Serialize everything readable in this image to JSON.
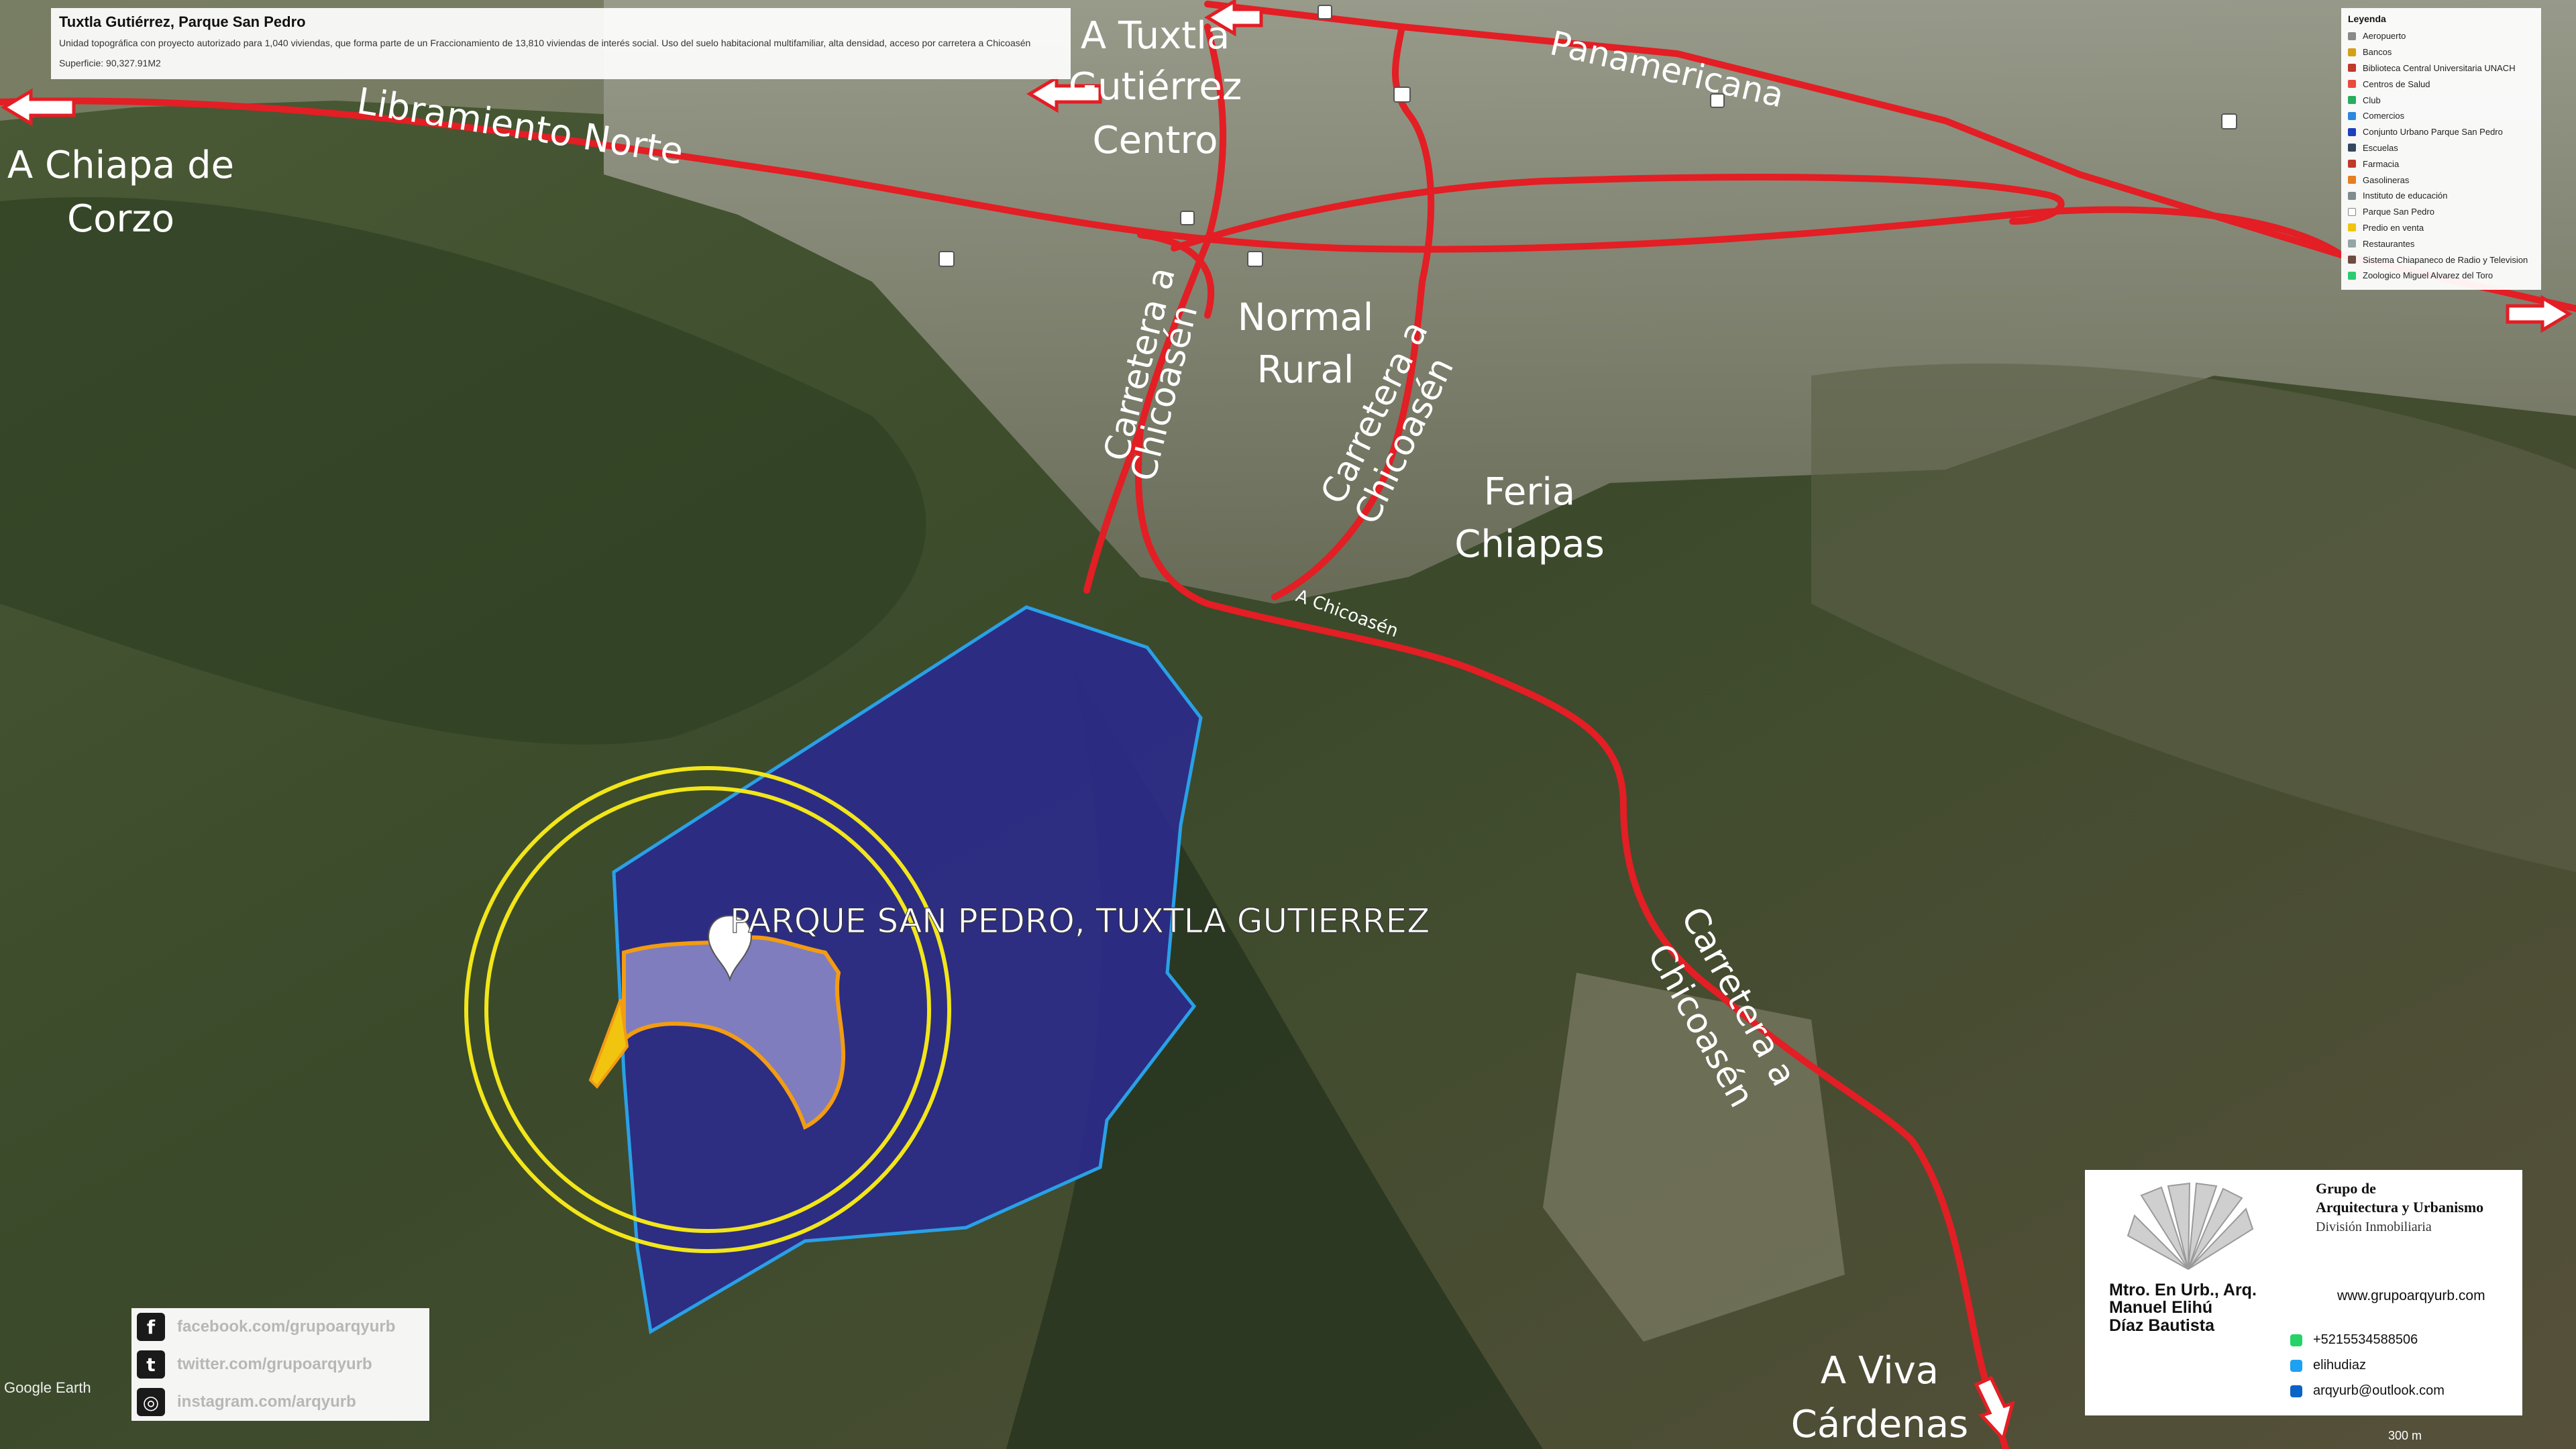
{
  "map": {
    "project_label": "PARQUE SAN PEDRO, TUXTLA GUTIERREZ",
    "place_labels": {
      "chiapa_a": "A Chiapa de",
      "chiapa_b": "Corzo",
      "tuxtla_a": "A Tuxtla",
      "tuxtla_b": "Gutiérrez",
      "tuxtla_c": "Centro",
      "normal_a": "Normal",
      "normal_b": "Rural",
      "feria_a": "Feria",
      "feria_b": "Chiapas",
      "viva_a": "A Viva",
      "viva_b": "Cárdenas"
    },
    "road_labels": {
      "libramiento": "Libramiento Norte",
      "panamericana": "Panamericana",
      "carretera_a": "Carretera a",
      "chicoasen": "Chicoasén",
      "chicoasen_small": "A Chicoasén"
    },
    "colors": {
      "road": "#e31e24",
      "polygon_fill": "#2b2a8c",
      "polygon_stroke": "#2aa0e6",
      "inner_fill": "#8e8cc8",
      "inner_stroke": "#f39c12",
      "ring": "#f2e61a",
      "terrain_dark": "#2d3d22",
      "terrain_light": "#6d6a50"
    }
  },
  "info_panel": {
    "title": "Tuxtla Gutiérrez, Parque San Pedro",
    "description": "Unidad topográfica con proyecto autorizado para 1,040 viviendas, que forma parte de un Fraccionamiento de 13,810 viviendas de interés social. Uso del suelo habitacional multifamiliar, alta densidad, acceso por carretera a Chicoasén",
    "area": "Superficie: 90,327.91M2"
  },
  "legend": {
    "title": "Leyenda",
    "items": [
      {
        "label": "Aeropuerto",
        "color": "#8a8a8a"
      },
      {
        "label": "Bancos",
        "color": "#d4a017"
      },
      {
        "label": "Biblioteca Central Universitaria UNACH",
        "color": "#c0392b"
      },
      {
        "label": "Centros de Salud",
        "color": "#e74c3c"
      },
      {
        "label": "Club",
        "color": "#27ae60"
      },
      {
        "label": "Comercios",
        "color": "#2e86de"
      },
      {
        "label": "Conjunto Urbano Parque San Pedro",
        "color": "#1f3fbf"
      },
      {
        "label": "Escuelas",
        "color": "#34495e"
      },
      {
        "label": "Farmacia",
        "color": "#c0392b"
      },
      {
        "label": "Gasolineras",
        "color": "#e67e22"
      },
      {
        "label": "Instituto de educación",
        "color": "#7f8c8d"
      },
      {
        "label": "Parque San Pedro",
        "color": "#ffffff"
      },
      {
        "label": "Predio en venta",
        "color": "#f1c40f"
      },
      {
        "label": "Restaurantes",
        "color": "#95a5a6"
      },
      {
        "label": "Sistema Chiapaneco de Radio y Television",
        "color": "#6d4c41"
      },
      {
        "label": "Zoologico Miguel Alvarez del Toro",
        "color": "#2ecc71"
      }
    ]
  },
  "social": {
    "facebook": "facebook.com/grupoarqyurb",
    "twitter": "twitter.com/grupoarqyurb",
    "instagram": "instagram.com/arqyurb"
  },
  "card": {
    "group_line1": "Grupo de",
    "group_line2": "Arquitectura y Urbanismo",
    "division": "División Inmobiliaria",
    "name_line1": "Mtro. En Urb., Arq.",
    "name_line2": "Manuel Elihú",
    "name_line3": "Díaz Bautista",
    "website": "www.grupoarqyurb.com",
    "phone": "+5215534588506",
    "skype": "elihudiaz",
    "email": "arqyurb@outlook.com"
  },
  "brand": "Google Earth",
  "scale": "300 m"
}
